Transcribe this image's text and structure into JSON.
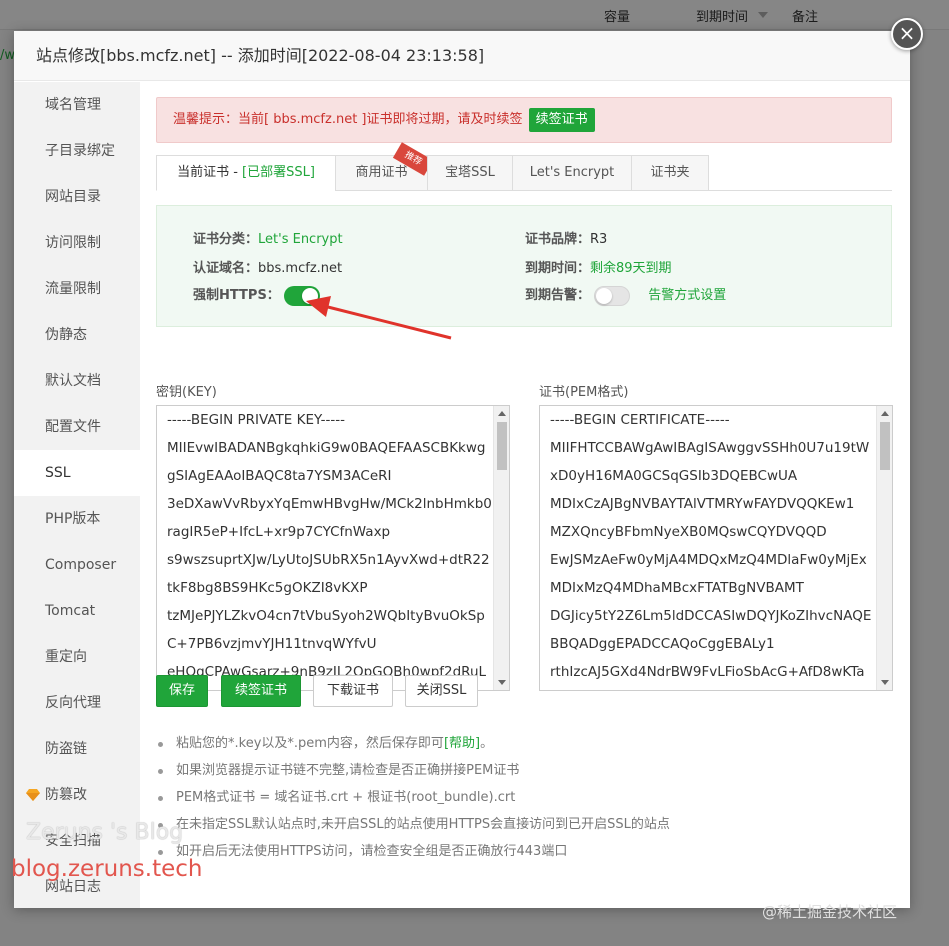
{
  "background": {
    "columns": [
      "容量",
      "到期时间",
      "备注"
    ],
    "link_fragment": "/w"
  },
  "modal": {
    "title": "站点修改[bbs.mcfz.net] -- 添加时间[2022-08-04 23:13:58]",
    "close_symbol": "×"
  },
  "sidebar": {
    "items": [
      {
        "label": "域名管理"
      },
      {
        "label": "子目录绑定"
      },
      {
        "label": "网站目录"
      },
      {
        "label": "访问限制"
      },
      {
        "label": "流量限制"
      },
      {
        "label": "伪静态"
      },
      {
        "label": "默认文档"
      },
      {
        "label": "配置文件"
      },
      {
        "label": "SSL"
      },
      {
        "label": "PHP版本"
      },
      {
        "label": "Composer"
      },
      {
        "label": "Tomcat"
      },
      {
        "label": "重定向"
      },
      {
        "label": "反向代理"
      },
      {
        "label": "防盗链"
      },
      {
        "label": "防篡改"
      },
      {
        "label": "安全扫描"
      },
      {
        "label": "网站日志"
      }
    ],
    "active_index": 8
  },
  "notice": {
    "text": "温馨提示：当前[ bbs.mcfz.net ]证书即将过期，请及时续签",
    "button": "续签证书"
  },
  "tabs": [
    {
      "label": "当前证书 - ",
      "status": "[已部署SSL]"
    },
    {
      "label": "商用证书",
      "badge": "推荐"
    },
    {
      "label": "宝塔SSL"
    },
    {
      "label": "Let's Encrypt"
    },
    {
      "label": "证书夹"
    }
  ],
  "cert_info": {
    "category_label": "证书分类：",
    "category_value": "Let's Encrypt",
    "brand_label": "证书品牌：",
    "brand_value": "R3",
    "domain_label": "认证域名：",
    "domain_value": "bbs.mcfz.net",
    "expiry_label": "到期时间：",
    "expiry_value": "剩余89天到期",
    "force_https_label": "强制HTTPS：",
    "force_https_on": true,
    "expiry_alert_label": "到期告警：",
    "expiry_alert_on": false,
    "alert_settings_link": "告警方式设置"
  },
  "key_panel": {
    "label": "密钥(KEY)",
    "lines": [
      "-----BEGIN PRIVATE KEY-----",
      "MIIEvwIBADANBgkqhkiG9w0BAQEFAASCBKkwg",
      "gSIAgEAAoIBAQC8ta7YSM3ACeRI",
      "3eDXawVvRbyxYqEmwHBvgHw/MCk2lnbHmkb0",
      "ragIR5eP+IfcL+xr9p7CYCfnWaxp",
      "s9wszsuprtXJw/LyUtoJSUbRX5n1AyvXwd+dtR22",
      "tkF8bg8BS9HKc5gOKZI8vKXP",
      "tzMJePJYLZkvO4cn7tVbuSyoh2WQbItyBvuOkSp",
      "C+7PB6vzjmvYJH11tnvqWYfvU",
      "eHOqCPAwGsarz+9nB9zIL2QpGOBh0wpf2dRuL"
    ]
  },
  "cert_panel": {
    "label": "证书(PEM格式)",
    "lines": [
      "-----BEGIN CERTIFICATE-----",
      "MIIFHTCCBAWgAwIBAgISAwggvSSHh0U7u19tW",
      "xD0yH16MA0GCSqGSIb3DQEBCwUA",
      "MDIxCzAJBgNVBAYTAlVTMRYwFAYDVQQKEw1",
      "MZXQncyBFbmNyeXB0MQswCQYDVQQD",
      "EwJSMzAeFw0yMjA4MDQxMzQ4MDlaFw0yMjEx",
      "MDIxMzQ4MDhaMBcxFTATBgNVBAMT",
      "DGJicy5tY2Z6Lm5ldDCCASIwDQYJKoZIhvcNAQE",
      "BBQADggEPADCCAQoCggEBALy1",
      "rthIzcAJ5GXd4NdrBW9FvLFioSbAcG+AfD8wKTa"
    ]
  },
  "actions": {
    "save": "保存",
    "renew": "续签证书",
    "download": "下载证书",
    "disable": "关闭SSL"
  },
  "tips": [
    {
      "text": "粘贴您的*.key以及*.pem内容，然后保存即可",
      "help": "[帮助]",
      "after": "。"
    },
    {
      "text": "如果浏览器提示证书链不完整,请检查是否正确拼接PEM证书"
    },
    {
      "text": "PEM格式证书 = 域名证书.crt + 根证书(root_bundle).crt"
    },
    {
      "text": "在未指定SSL默认站点时,未开启SSL的站点使用HTTPS会直接访问到已开启SSL的站点"
    },
    {
      "text": "如开启后无法使用HTTPS访问，请检查安全组是否正确放行443端口"
    }
  ],
  "watermarks": {
    "blog_name": "Zeruns 's Blog",
    "blog_url": "blog.zeruns.tech",
    "juejin": "@稀土掘金技术社区"
  },
  "colors": {
    "accent_green": "#20a53a",
    "notice_red": "#c9302c",
    "annotation_arrow": "#e0332b"
  }
}
